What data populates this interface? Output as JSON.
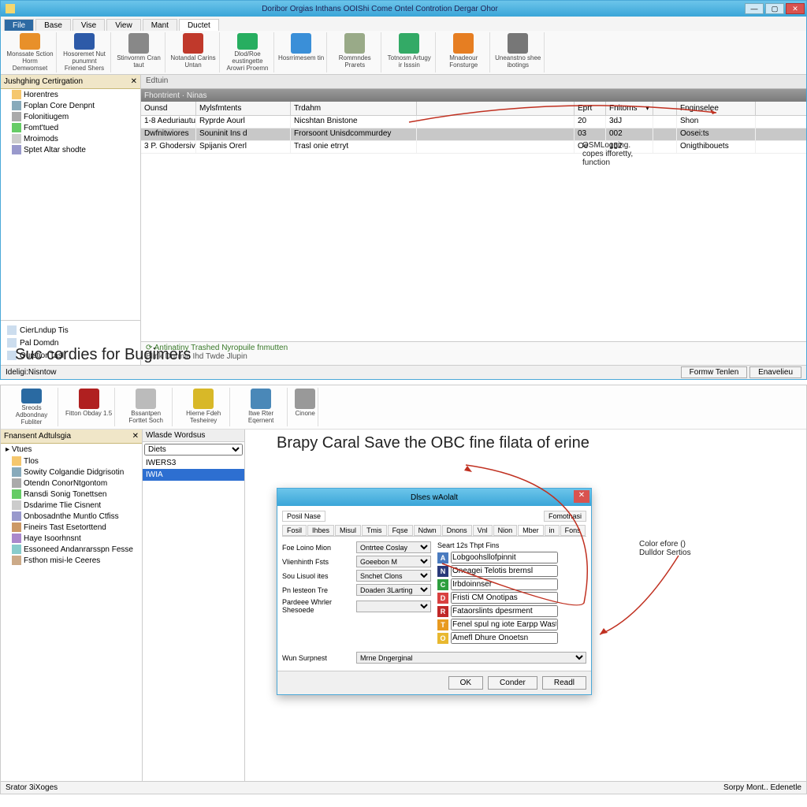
{
  "top_window": {
    "title": "Doribor Orgias Inthans OOIShi Come Ontel Controtion Dergar Ohor",
    "menu_tabs": [
      "File",
      "Base",
      "Vise",
      "View",
      "Mant",
      "Ductet"
    ],
    "active_tab": 5,
    "ribbon": [
      {
        "label": "Monssate Sction Horm Demwomset",
        "icon": "person-orange-icon"
      },
      {
        "label": "Hosoremet Nut punumnt Friened Shers",
        "icon": "shield-blue-icon"
      },
      {
        "label": "Stinvornm Cran taut",
        "icon": "scissors-icon"
      },
      {
        "label": "Notandal Carins Untan",
        "icon": "play-red-icon"
      },
      {
        "label": "Dlod/Roe eustingette Arowri Proemn",
        "icon": "square-green-icon"
      },
      {
        "label": "Hosrrimesem tin",
        "icon": "globe-icon"
      },
      {
        "label": "Rommndes Prarets",
        "icon": "form-icon"
      },
      {
        "label": "Totnosm Artugy ir Isssin",
        "icon": "people-icon"
      },
      {
        "label": "Mnadeour Fonsturge",
        "icon": "swirl-orange-icon"
      },
      {
        "label": "Uneanstno shee ibotings",
        "icon": "circle-icon"
      }
    ],
    "tree": {
      "header": "Jushghing Certirgation",
      "items": [
        {
          "label": "Horentres",
          "icon": "folder-blue-icon"
        },
        {
          "label": "Foplan Core Denpnt",
          "icon": "folder-icon"
        },
        {
          "label": "Folonitiugem",
          "icon": "dash-icon"
        },
        {
          "label": "Fomt'tued",
          "icon": "folder-green-icon"
        },
        {
          "label": "Mroimods",
          "icon": "file-icon"
        },
        {
          "label": "Sptet Altar shodte",
          "icon": "db-icon"
        }
      ],
      "footer_items": [
        {
          "label": "CierLndup Tis",
          "icon": "doc-green-icon"
        },
        {
          "label": "Pal Domdn",
          "icon": "doc-icon"
        },
        {
          "label": "Ourstior Tasl",
          "icon": "doc-blue-icon"
        }
      ]
    },
    "grid": {
      "breadcrumb": "Edtuin",
      "header": "Fhontrient · Ninas",
      "columns": [
        "Ounsd",
        "Mylsfmtents",
        "Trdahm",
        "",
        "Eprt",
        "Fnitoms",
        "",
        "Fnginselee"
      ],
      "rows": [
        {
          "cells": [
            "1-8  Aeduriautus",
            "Ryprde Aourl",
            "Nicshtan Bnistone",
            "",
            "20",
            "3dJ",
            "",
            "Shon"
          ],
          "sel": false
        },
        {
          "cells": [
            "Dwfnitwiores",
            "Souninit Ins d",
            "Frorsoont Unisdcommurdey",
            "",
            "03",
            "002",
            "",
            "Oosei:ts"
          ],
          "sel": true
        },
        {
          "cells": [
            "3 P.  Ghodersivens",
            "Spijanis Orerl",
            "Trasl onie etrryt",
            "",
            "Oe",
            "152",
            "",
            "Onigthibouets"
          ],
          "sel": false
        }
      ]
    },
    "bottom": {
      "line1": "Antinatiny  Trashed Nyropuile fnmutten",
      "line2": "Blink Durmin Ihd Twde Jlupin"
    },
    "status": {
      "left": "Ideligi:Nisntow",
      "btn1": "Formw Tenlen",
      "btn2": "Enavelieu"
    },
    "annotations": {
      "a1": "OSMLogging.",
      "a2": "copes ifforetty,",
      "a3": "function",
      "caption": "Suc cordies for Bugimers"
    }
  },
  "bottom_window": {
    "ribbon": [
      {
        "label": "Sreods Adbondnay Fubliter",
        "icon": "shield2-icon"
      },
      {
        "label": "Fitton Obday 1.5",
        "icon": "badge-red-icon"
      },
      {
        "label": "Bssantpen Forttet Soch",
        "icon": "card-icon"
      },
      {
        "label": "Hierne Fdeh Tesheirey",
        "icon": "tool-yellow-icon"
      },
      {
        "label": "Itwe Rter Eqernent",
        "icon": "printer-icon"
      },
      {
        "label": "Cinone",
        "icon": "ring-icon"
      }
    ],
    "tree": {
      "header": "Fnansent Adtulsgia",
      "caret": "Vtues",
      "items": [
        {
          "label": "Tlos",
          "icon": "folder-yellow-icon"
        },
        {
          "label": "Sowity Colgandie Didgrisotin",
          "icon": "app1-icon"
        },
        {
          "label": "Otendn ConorNtgontom",
          "icon": "app2-icon"
        },
        {
          "label": "Ransdi Sonig Tonettsen",
          "icon": "app3-icon"
        },
        {
          "label": "Dsdarime Tlie Cisnent",
          "icon": "app4-icon"
        },
        {
          "label": "Onbosadnthe Muntlo Ctfiss",
          "icon": "app5-icon"
        },
        {
          "label": "Fineirs Tast Esetorttend",
          "icon": "app6-icon"
        },
        {
          "label": "Haye Isoorhnsnt",
          "icon": "folder-icon"
        },
        {
          "label": "Essoneed Andanrarsspn Fesse",
          "icon": "doc-icon"
        },
        {
          "label": "Fsthon misi-le Ceeres",
          "icon": "doc-icon"
        }
      ]
    },
    "mid": {
      "header": "Wlasde Wordsus",
      "dropdown": "Diets",
      "items": [
        "IWERS3",
        "IWIA"
      ],
      "selected": 1
    },
    "dialog": {
      "title": "Dlses wAolalt",
      "top_tabs": [
        "Posil  Nase",
        "Fomotnasi"
      ],
      "sub_tabs": [
        "Fosil",
        "Ihbes",
        "Misul",
        "Tmis",
        "Fqse",
        "Ndwn",
        "Dnons",
        "Vnl",
        "Nion",
        "Mber",
        "in",
        "Fons"
      ],
      "left_fields": [
        {
          "label": "Foe Loino Mion",
          "value": "Ontrtee Coslay"
        },
        {
          "label": "Vlienhinth Fsts",
          "value": "Goeebon M"
        },
        {
          "label": "Sou Lisuol ites",
          "value": "Snchet Clons"
        },
        {
          "label": "Pn lesteon Tre",
          "value": "Doaden 3Larting"
        },
        {
          "label": "Pardeee Whrler Shesoede",
          "value": ""
        }
      ],
      "right_header": "Seart 12s Thpt Fins",
      "color_rows": [
        {
          "letter": "A",
          "bg": "#4a7bbf",
          "text": "Lobgoohsllofpinnit"
        },
        {
          "letter": "N",
          "bg": "#2a3a7a",
          "text": "Oneagei Telotis brernsl"
        },
        {
          "letter": "C",
          "bg": "#2e9e3e",
          "text": "Irbdoinnser"
        },
        {
          "letter": "D",
          "bg": "#d94040",
          "text": "Fristi CM Onotipas"
        },
        {
          "letter": "R",
          "bg": "#c02828",
          "text": "Fataorslints dpesrment"
        },
        {
          "letter": "T",
          "bg": "#e89a20",
          "text": "Fenel spul ng iote Earpp Wasts"
        },
        {
          "letter": "O",
          "bg": "#e8b830",
          "text": "Amefl Dhure Onoetsn"
        }
      ],
      "bottom_field": {
        "label": "Wun Surpnest",
        "value": "Mrne Dngerginal"
      },
      "buttons": [
        "OK",
        "Conder",
        "Readl"
      ]
    },
    "annotations": {
      "title": "Brapy Caral Save the OBC fine filata of erine",
      "side1": "Color efore ()",
      "side2": "Dulldor Sertios"
    },
    "status": {
      "left": "Srator 3iXoges",
      "right": "Sorpy Mont.. Edenetle"
    }
  }
}
